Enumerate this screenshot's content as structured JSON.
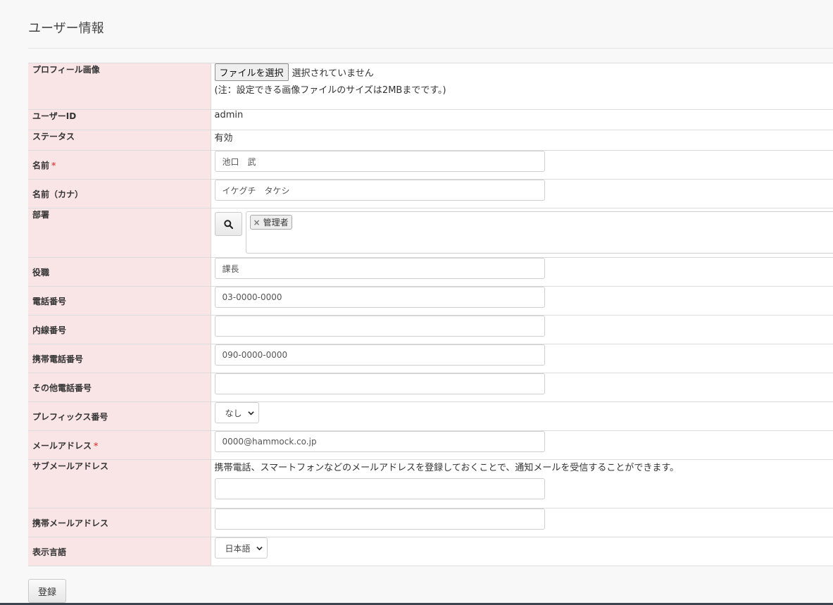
{
  "page": {
    "title": "ユーザー情報"
  },
  "form": {
    "profile_image": {
      "label": "プロフィール画像",
      "button_label": "ファイルを選択",
      "status": "選択されていません",
      "note": "(注：設定できる画像ファイルのサイズは2MBまでです。)"
    },
    "user_id": {
      "label": "ユーザーID",
      "value": "admin"
    },
    "status": {
      "label": "ステータス",
      "value": "有効"
    },
    "name": {
      "label": "名前",
      "required_mark": "*",
      "value": "池口　武"
    },
    "name_kana": {
      "label": "名前（カナ）",
      "value": "イケグチ　タケシ"
    },
    "department": {
      "label": "部署",
      "tags": [
        "管理者"
      ],
      "tag_remove": "×"
    },
    "position": {
      "label": "役職",
      "value": "課長"
    },
    "phone": {
      "label": "電話番号",
      "value": "03-0000-0000"
    },
    "extension": {
      "label": "内線番号",
      "value": ""
    },
    "mobile": {
      "label": "携帯電話番号",
      "value": "090-0000-0000"
    },
    "other_phone": {
      "label": "その他電話番号",
      "value": ""
    },
    "prefix": {
      "label": "プレフィックス番号",
      "selected": "なし"
    },
    "email": {
      "label": "メールアドレス",
      "required_mark": "*",
      "value": "0000@hammock.co.jp"
    },
    "sub_email": {
      "label": "サブメールアドレス",
      "help": "携帯電話、スマートフォンなどのメールアドレスを登録しておくことで、通知メールを受信することができます。",
      "value": ""
    },
    "mobile_email": {
      "label": "携帯メールアドレス",
      "value": ""
    },
    "language": {
      "label": "表示言語",
      "selected": "日本語"
    }
  },
  "actions": {
    "submit_label": "登録"
  },
  "colors": {
    "label_bg": "#f9e5e6",
    "required": "#d9534f"
  }
}
